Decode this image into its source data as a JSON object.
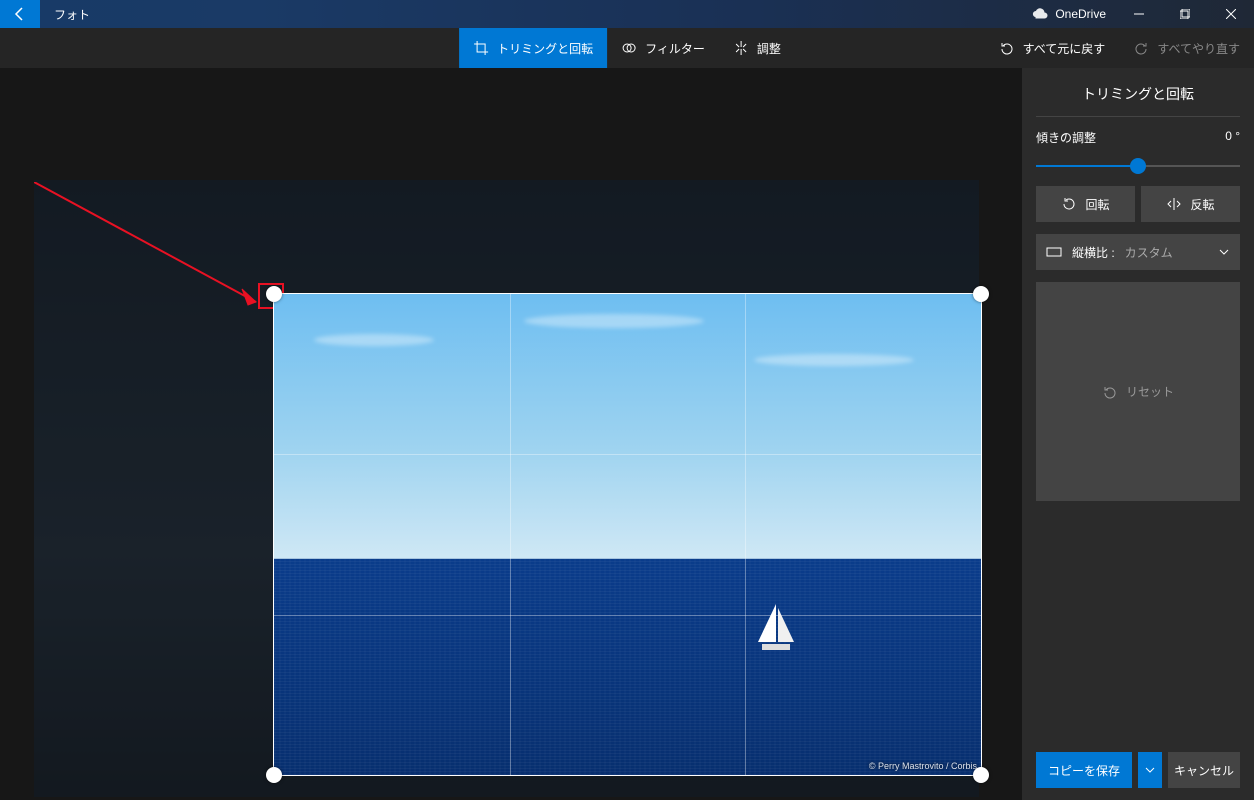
{
  "title": "フォト",
  "onedrive": "OneDrive",
  "tabs": {
    "crop": "トリミングと回転",
    "filter": "フィルター",
    "adjust": "調整"
  },
  "toolbar": {
    "undo_all": "すべて元に戻す",
    "redo_all": "すべてやり直す"
  },
  "panel": {
    "title": "トリミングと回転",
    "tilt_label": "傾きの調整",
    "tilt_value": "0 °",
    "rotate": "回転",
    "flip": "反転",
    "aspect_label": "縦横比 :",
    "aspect_value": "カスタム",
    "reset": "リセット",
    "save": "コピーを保存",
    "cancel": "キャンセル"
  },
  "image": {
    "credit": "© Perry Mastrovito / Corbis"
  }
}
